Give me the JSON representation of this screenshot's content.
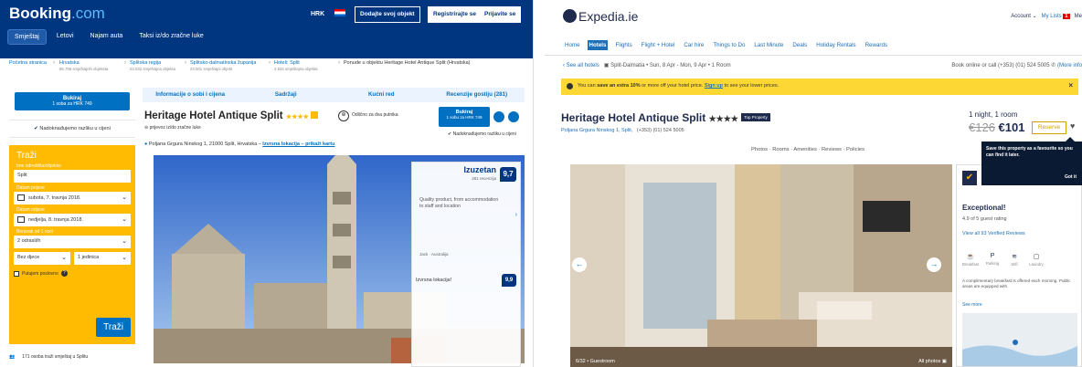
{
  "booking": {
    "logo_main": "Booking",
    "logo_ext": ".com",
    "currency": "HRK",
    "list_property": "Dodajte svoj objekt",
    "register": "Registrirajte se",
    "sign_in": "Prijavite se",
    "nav": [
      "Smještaj",
      "Letovi",
      "Najam auta",
      "Taksi iz/do zračne luke"
    ],
    "crumbs": [
      {
        "label": "Početna stranica",
        "sub": ""
      },
      {
        "label": "Hrvatska",
        "sub": "86.758 smještajnih objekata"
      },
      {
        "label": "Splitska regija",
        "sub": "23.032 smještajna objekta"
      },
      {
        "label": "Splitsko-dalmatinska županija",
        "sub": "23.001 smještajni objekt"
      },
      {
        "label": "Hoteli: Split",
        "sub": "4.534 smještajna objekta"
      },
      {
        "label": "Ponude u objektu Heritage Hotel Antique Split (Hrvatska)",
        "sub": ""
      }
    ],
    "book_btn": "Bukiraj",
    "book_sub": "1 soba za HRK 749",
    "price_match": "Nadoknađujemo razliku u cijeni",
    "search": {
      "title": "Traži",
      "dest_label": "Ime odredišta/objekta:",
      "dest_value": "Split",
      "checkin_label": "Datum prijave",
      "checkin_value": "subota, 7. travnja 2018.",
      "checkout_label": "Datum odjave",
      "checkout_value": "nedjelja, 8. travnja 2018.",
      "nights_label": "Boravak od 1 noći",
      "adults": "2 odrasli/h",
      "children": "Bez djece",
      "rooms": "1 jedinica",
      "business": "Putujem poslovno",
      "submit": "Traži"
    },
    "viewers": "171 osoba traži smještaj u Splitu",
    "tabs": [
      "Informacije o sobi i cijena",
      "Sadržaji",
      "Kućni red",
      "Recenzije gostiju (281)"
    ],
    "hotel_name": "Heritage Hotel Antique Split",
    "stars": "★★★★",
    "couples": "Odlično za dva putnika",
    "pref": "prijevoz iz/do zračne luke",
    "address": "Poljana Grgura Ninskog 1, 21000 Split, Hrvatska",
    "address_link": "Izvrsna lokacija – prikaži kartu",
    "right_book": "Bukiraj",
    "right_book_sub": "1 sobu za HRK 749",
    "right_pm": "Nadoknađujemo razliku u cijeni",
    "score_word": "Izuzetan",
    "score_reviews": "281 recenzija",
    "score": "9,7",
    "quote": "Quality product, from accommodation to staff and location",
    "reviewer": "Jack",
    "reviewer_country": "Australija",
    "location_label": "Izvrsna lokacija!",
    "location_score": "9,9"
  },
  "expedia": {
    "logo": "Expedia.ie",
    "account": "Account",
    "my_lists": "My Lists",
    "lists_count": "1",
    "more": "Me",
    "nav": [
      "Home",
      "Hotels",
      "Flights",
      "Flight + Hotel",
      "Car hire",
      "Things to Do",
      "Last Minute",
      "Deals",
      "Holiday Rentals",
      "Rewards"
    ],
    "see_all": "‹ See all hotels",
    "trip": "Split-Dalmatia • Sun, 8 Apr - Mon, 9 Apr • 1 Room",
    "phone": "Book online or call (+353) (01) 524 5005",
    "more_info": "(More info",
    "promo_prefix": "You can",
    "promo_bold": "save an extra 10%",
    "promo_mid": "or more off your hotel price.",
    "promo_link": "Sign up",
    "promo_suffix": "to see your lower prices.",
    "hotel_name": "Heritage Hotel Antique Split",
    "stars": "★★★★",
    "top_property": "Top Property",
    "address": "Poljana Grgura Ninskog 1, Split,",
    "phone_hotel": "(+353) (01) 524 5005",
    "room_info": "1 night, 1 room",
    "old_price": "€126",
    "new_price": "€101",
    "reserve": "Reserve",
    "tabs": "Photos · Rooms · Amenities · Reviews · Policies",
    "tooltip": "Save this property as a favourite so you can find it later.",
    "tooltip_btn": "Got it",
    "photo_caption": "6/32 • Guestroom",
    "all_photos": "All photos",
    "rating_word": "Exceptional!",
    "rating": "4.9 of 5 guest rating",
    "reviews_link": "View all 93 Verified Reviews",
    "amenities": [
      "Breakfast",
      "Parking",
      "Wifi",
      "Laundry"
    ],
    "desc": "A complimentary breakfast is offered each morning. Public areas are equipped with",
    "see_more": "See more"
  },
  "colors": {
    "booking_blue": "#003580",
    "booking_yellow": "#febb02",
    "expedia_navy": "#1f2b4d",
    "expedia_yellow": "#fdd835"
  }
}
